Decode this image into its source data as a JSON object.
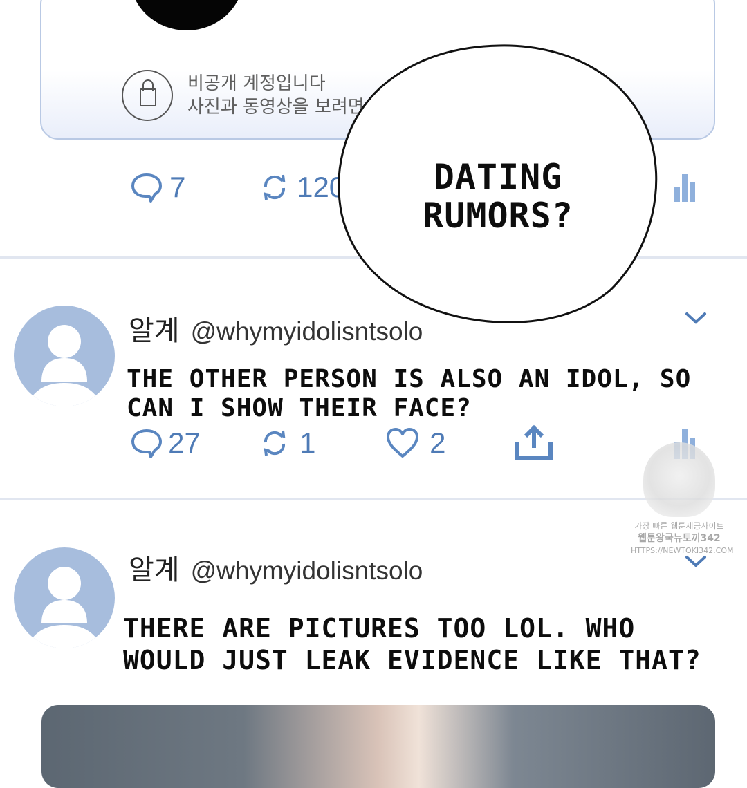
{
  "private_card": {
    "line1": "비공개 계정입니다",
    "line2": "사진과 동영상을 보려면"
  },
  "tweet1_stats": {
    "replies": "7",
    "retweets": "120"
  },
  "speech_bubble": {
    "line1": "DATING",
    "line2": "RUMORS?"
  },
  "tweet2": {
    "display_name": "알계",
    "handle": "@whymyidolisntsolo",
    "text_line1": "THE OTHER PERSON IS ALSO AN IDOL, SO",
    "text_line2": "CAN I SHOW THEIR FACE?",
    "replies": "27",
    "retweets": "1",
    "likes": "2"
  },
  "tweet3": {
    "display_name": "알계",
    "handle": "@whymyidolisntsolo",
    "text_line1": "THERE ARE PICTURES TOO LOL. WHO",
    "text_line2": "WOULD JUST LEAK EVIDENCE LIKE THAT?"
  },
  "watermark": {
    "line1": "가장 빠른 웹툰제공사이트",
    "line2": "웹툰왕국뉴토끼342",
    "line3": "HTTPS://NEWTOKI342.COM"
  },
  "colors": {
    "accent": "#4f7bb6",
    "avatar": "#a7bddd",
    "divider": "#e1e6f0"
  },
  "icons": [
    "reply-icon",
    "retweet-icon",
    "like-icon",
    "share-icon",
    "analytics-icon",
    "chevron-down-icon",
    "lock-icon",
    "default-avatar-icon"
  ]
}
